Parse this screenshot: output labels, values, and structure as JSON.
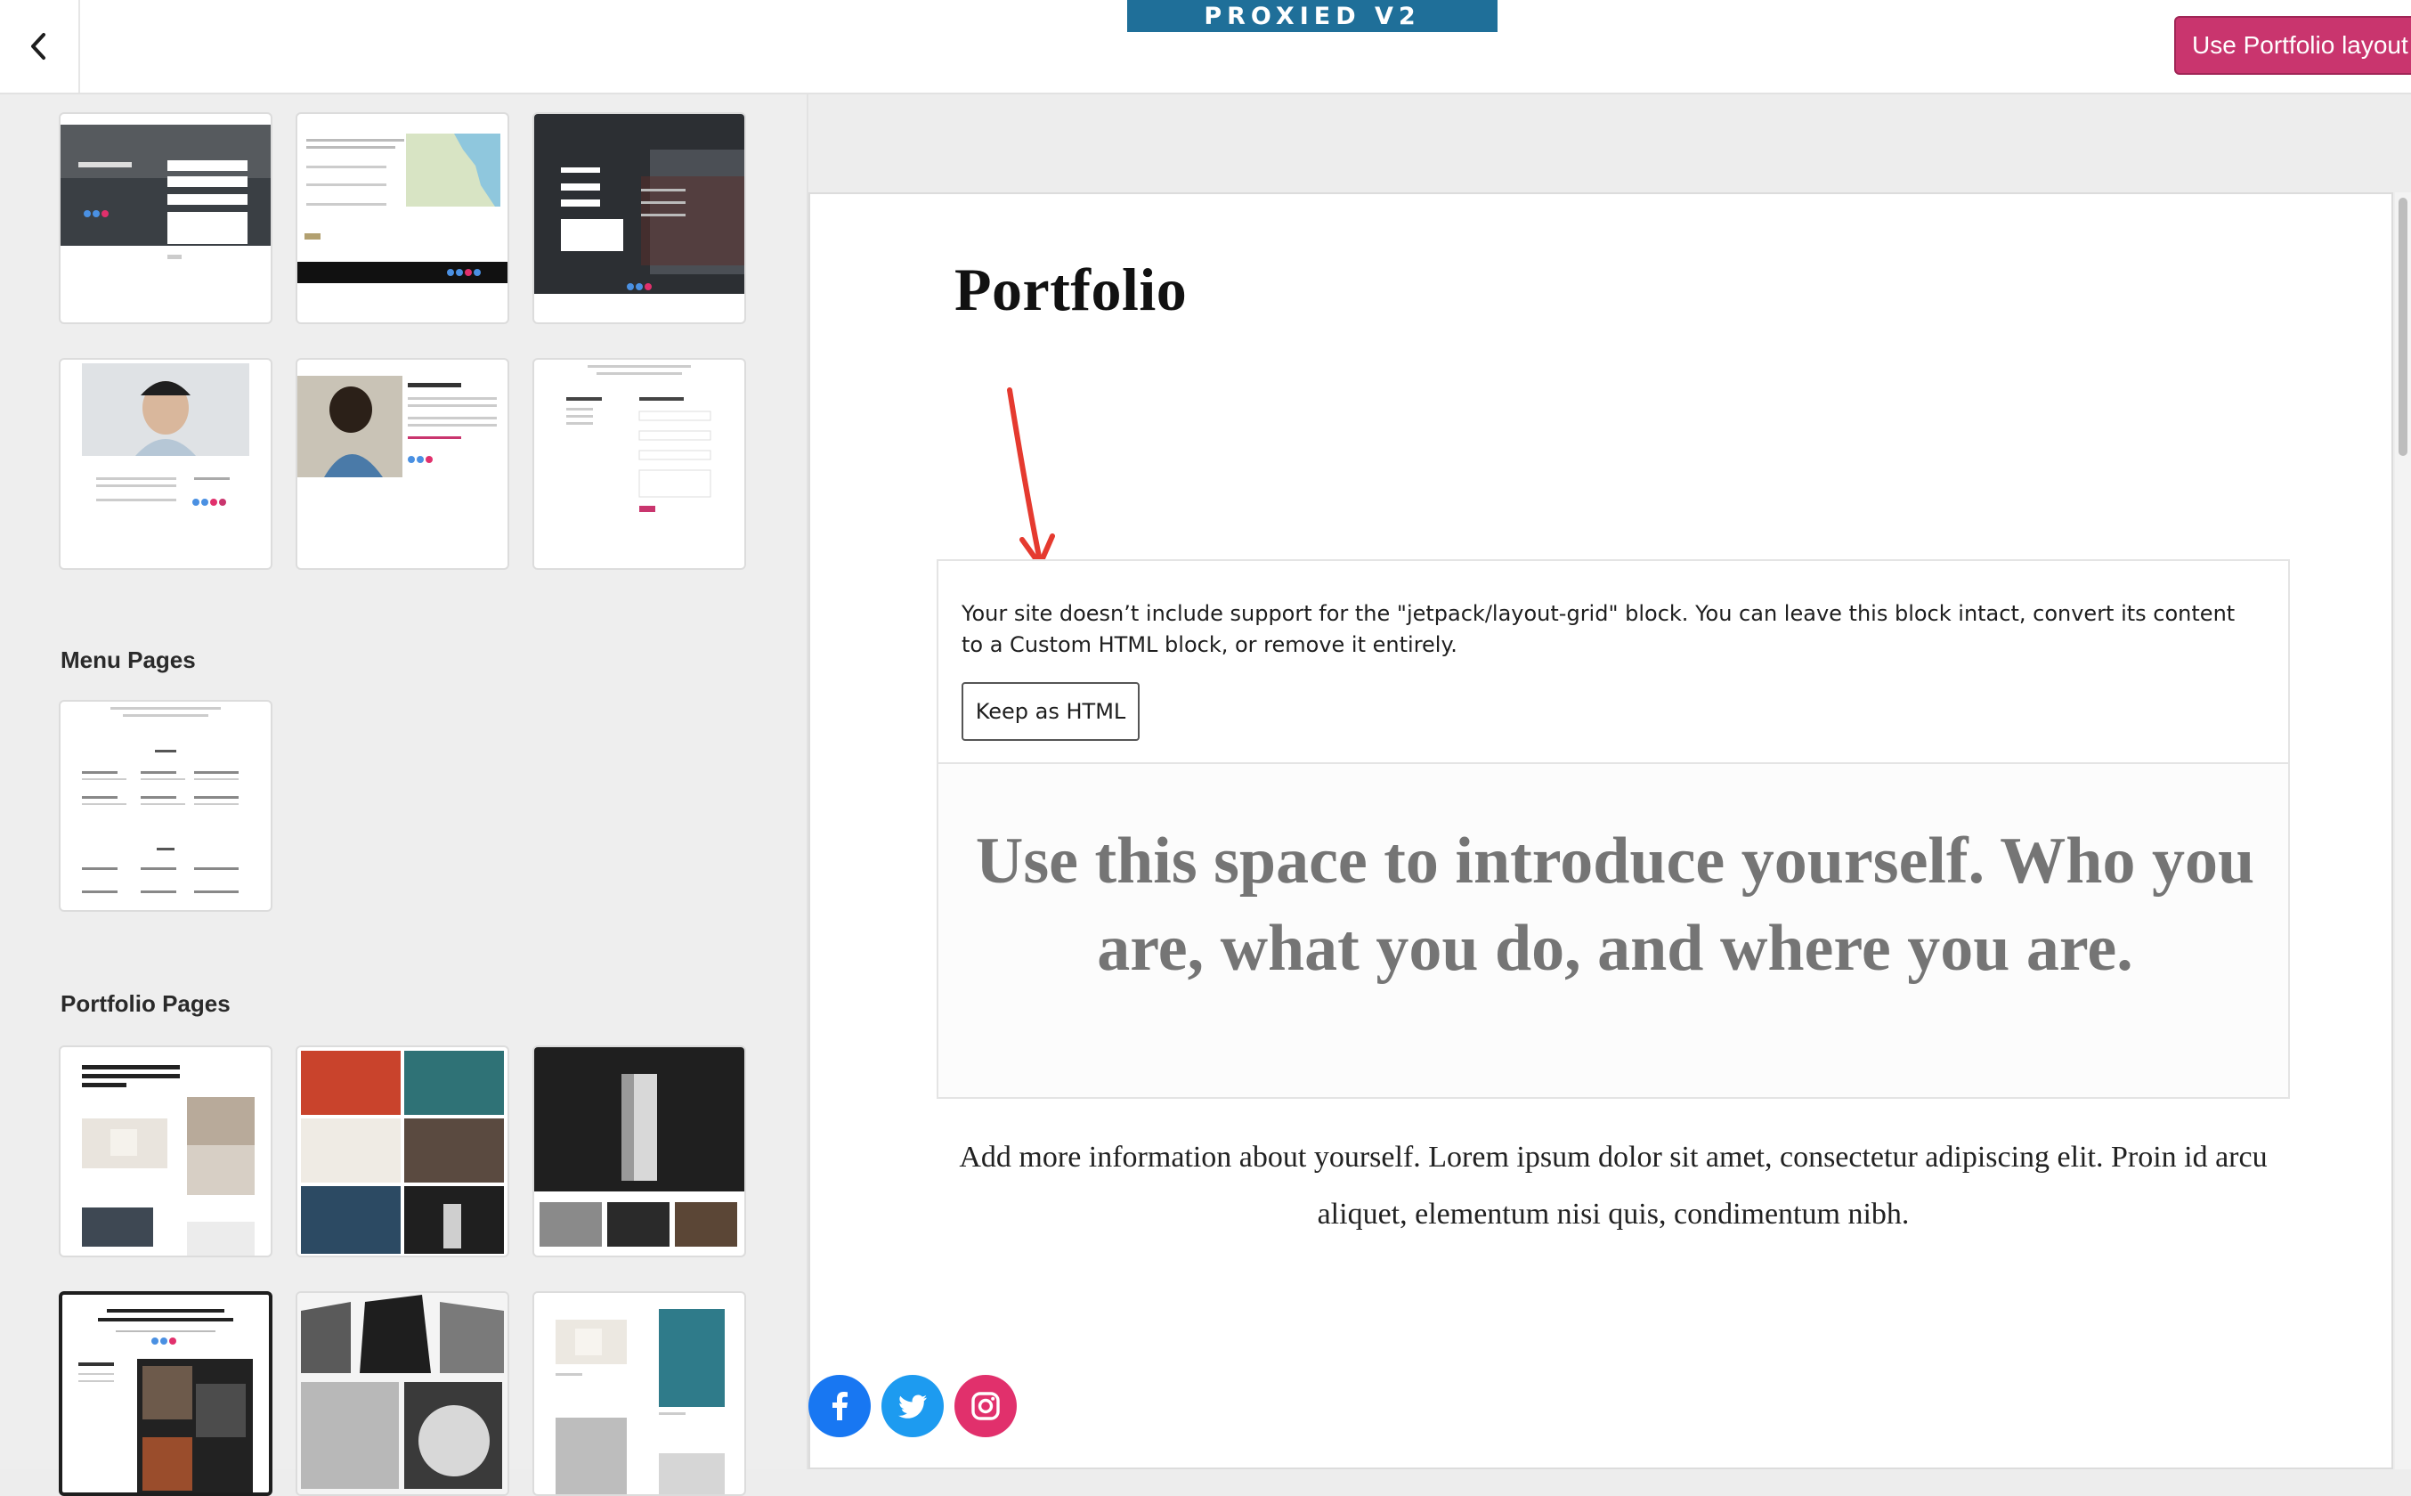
{
  "topbar": {
    "banner": "PROXIED V2",
    "use_button": "Use Portfolio layout"
  },
  "sidebar": {
    "sections": [
      "Menu Pages",
      "Portfolio Pages"
    ]
  },
  "preview": {
    "title": "Portfolio",
    "warning_text": "Your site doesn’t include support for the \"jetpack/layout-grid\" block. You can leave this block intact, convert its content to a Custom HTML block, or remove it entirely.",
    "keep_button": "Keep as HTML",
    "intro": "Use this space to introduce yourself. Who you are, what you do, and where you are.",
    "more_info": "Add more information about yourself. Lorem ipsum dolor sit amet, consectetur adipiscing elit. Proin id arcu aliquet, elementum nisi quis, condimentum nibh."
  },
  "social": [
    "facebook-icon",
    "twitter-icon",
    "instagram-icon"
  ],
  "colors": {
    "accent": "#c9356e",
    "banner": "#1f6f99",
    "facebook": "#1877f2",
    "twitter": "#1d9bf0",
    "instagram": "#e1306c",
    "annotation_arrow": "#e53a2f"
  }
}
